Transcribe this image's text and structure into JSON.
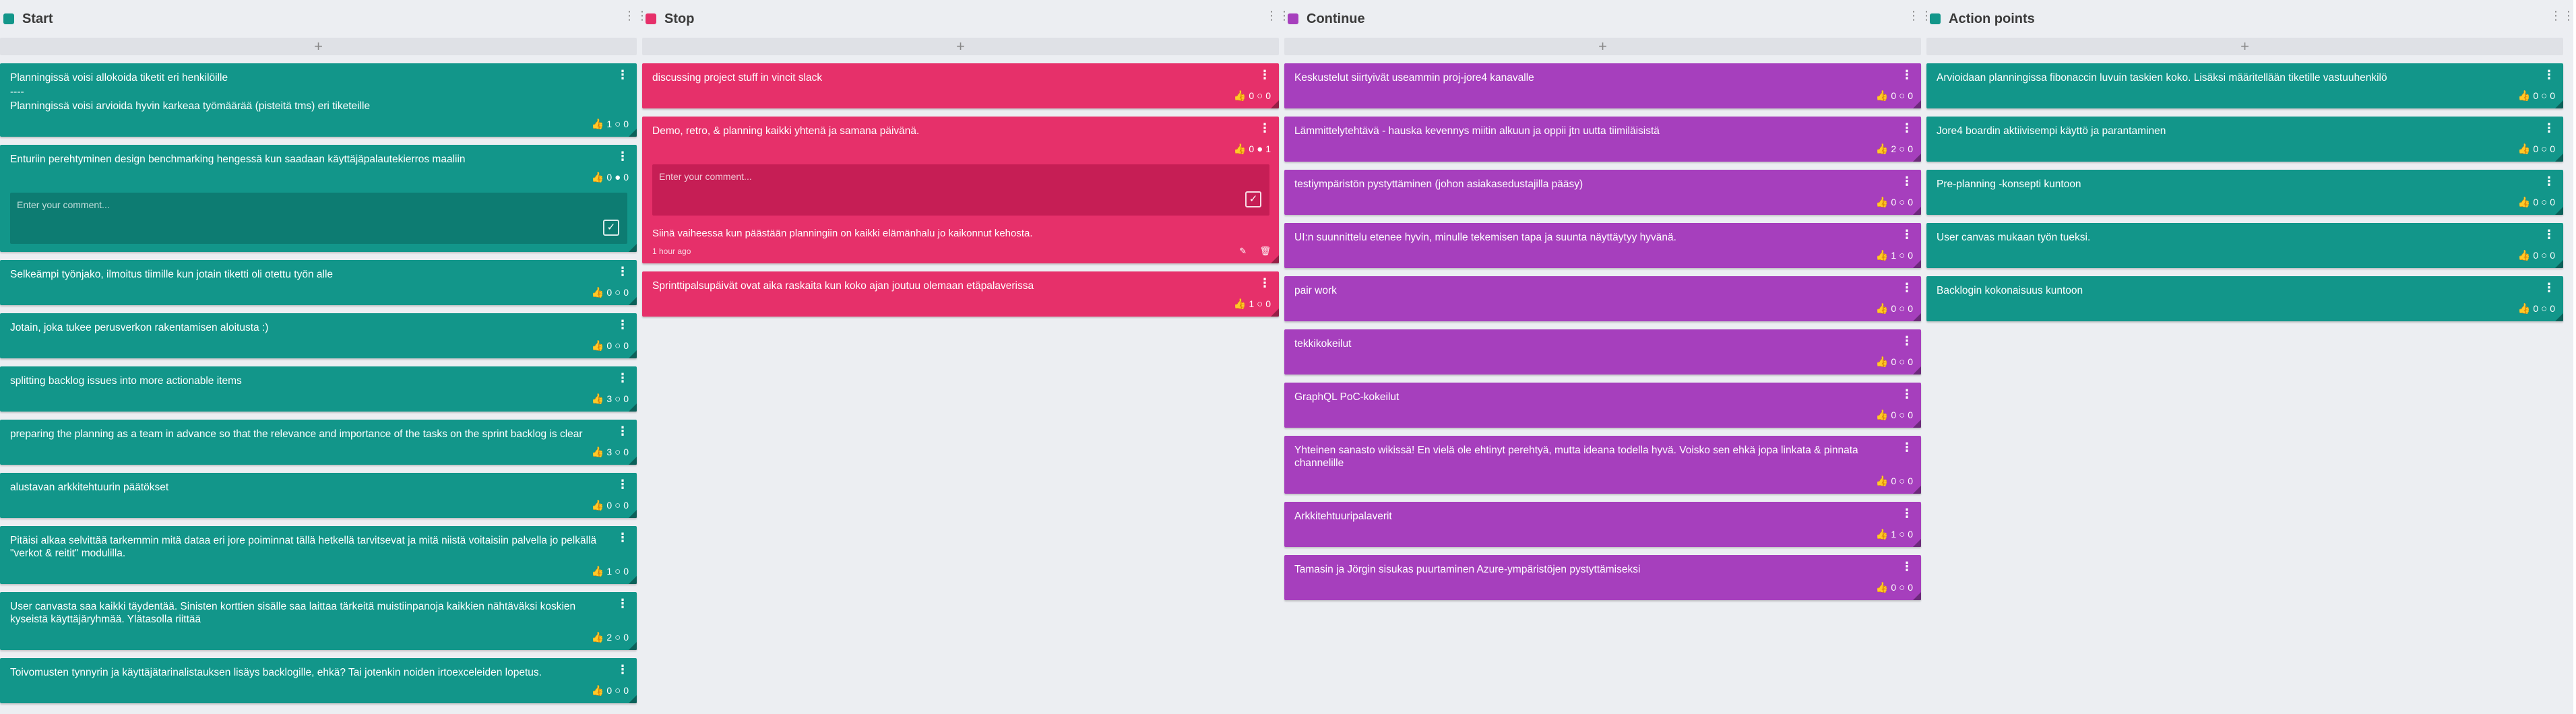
{
  "columns": [
    {
      "title": "Start",
      "color": "#12968a",
      "add": "+",
      "cards": [
        {
          "text": "Planningissä voisi allokoida tiketit eri henkilöille",
          "text2": "----",
          "text3": "Planningissä voisi arvioida hyvin karkeaa työmäärää (pisteitä tms) eri tiketeille",
          "likes": "1",
          "comments": "0"
        },
        {
          "text": "Enturiin perehtyminen design benchmarking hengessä kun saadaan käyttäjäpalautekierros maaliin",
          "likes": "0",
          "comments": "0",
          "comment_placeholder": "Enter your comment..."
        },
        {
          "text": "Selkeämpi työnjako, ilmoitus tiimille kun jotain tiketti oli otettu työn alle",
          "likes": "0",
          "comments": "0"
        },
        {
          "text": "Jotain, joka tukee perusverkon rakentamisen aloitusta :)",
          "likes": "0",
          "comments": "0"
        },
        {
          "text": "splitting backlog issues into more actionable items",
          "likes": "3",
          "comments": "0"
        },
        {
          "text": "preparing the planning as a team in advance so that the relevance and importance of the tasks on the sprint backlog is clear",
          "likes": "3",
          "comments": "0"
        },
        {
          "text": "alustavan arkkitehtuurin päätökset",
          "likes": "0",
          "comments": "0"
        },
        {
          "text": "Pitäisi alkaa selvittää tarkemmin mitä dataa eri jore poiminnat tällä hetkellä tarvitsevat ja mitä niistä voitaisiin palvella jo pelkällä \"verkot & reitit\" modulilla.",
          "likes": "1",
          "comments": "0"
        },
        {
          "text": "User canvasta saa kaikki täydentää. Sinisten korttien sisälle saa laittaa tärkeitä muistiinpanoja kaikkien nähtäväksi koskien kyseistä käyttäjäryhmää. Ylätasolla riittää",
          "likes": "2",
          "comments": "0"
        },
        {
          "text": "Toivomusten tynnyrin ja käyttäjätarinalistauksen lisäys backlogille, ehkä? Tai jotenkin noiden irtoexceleiden lopetus.",
          "likes": "0",
          "comments": "0"
        }
      ]
    },
    {
      "title": "Stop",
      "color": "#e6306a",
      "add": "+",
      "cards": [
        {
          "text": "discussing project stuff in vincit slack",
          "likes": "0",
          "comments": "0"
        },
        {
          "text": "Demo, retro, & planning kaikki yhtenä ja samana päivänä.",
          "likes": "0",
          "comments": "1",
          "comment_placeholder": "Enter your comment...",
          "comment_text": "Siinä vaiheessa kun päästään planningiin on kaikki elämänhalu jo kaikonnut kehosta.",
          "comment_time": "1 hour ago"
        },
        {
          "text": "Sprinttipalsupäivät ovat aika raskaita kun koko ajan joutuu olemaan etäpalaverissa",
          "likes": "1",
          "comments": "0"
        }
      ]
    },
    {
      "title": "Continue",
      "color": "#a63fbd",
      "add": "+",
      "cards": [
        {
          "text": "Keskustelut siirtyivät useammin proj-jore4 kanavalle",
          "likes": "0",
          "comments": "0"
        },
        {
          "text": "Lämmittelytehtävä - hauska kevennys miitin alkuun ja oppii jtn uutta tiimiläisistä",
          "likes": "2",
          "comments": "0"
        },
        {
          "text": "testiympäristön pystyttäminen (johon asiakasedustajilla pääsy)",
          "likes": "0",
          "comments": "0"
        },
        {
          "text": "UI:n suunnittelu etenee hyvin, minulle tekemisen tapa ja suunta näyttäytyy hyvänä.",
          "likes": "1",
          "comments": "0"
        },
        {
          "text": "pair work",
          "likes": "0",
          "comments": "0"
        },
        {
          "text": "tekkikokeilut",
          "likes": "0",
          "comments": "0"
        },
        {
          "text": "GraphQL PoC-kokeilut",
          "likes": "0",
          "comments": "0"
        },
        {
          "text": "Yhteinen sanasto wikissä! En vielä ole ehtinyt perehtyä, mutta ideana todella hyvä. Voisko sen ehkä jopa linkata & pinnata channelille",
          "likes": "0",
          "comments": "0"
        },
        {
          "text": "Arkkitehtuuripalaverit",
          "likes": "1",
          "comments": "0"
        },
        {
          "text": "Tamasin ja Jörgin sisukas puurtaminen Azure-ympäristöjen pystyttämiseksi",
          "likes": "0",
          "comments": "0"
        }
      ]
    },
    {
      "title": "Action points",
      "color": "#12968a",
      "add": "+",
      "cards": [
        {
          "text": "Arvioidaan planningissa fibonaccin luvuin taskien koko. Lisäksi määritellään tiketille vastuuhenkilö",
          "likes": "0",
          "comments": "0"
        },
        {
          "text": "Jore4 boardin aktiivisempi käyttö ja parantaminen",
          "likes": "0",
          "comments": "0"
        },
        {
          "text": "Pre-planning -konsepti kuntoon",
          "likes": "0",
          "comments": "0"
        },
        {
          "text": "User canvas mukaan työn tueksi.",
          "likes": "0",
          "comments": "0"
        },
        {
          "text": "Backlogin kokonaisuus kuntoon",
          "likes": "0",
          "comments": "0"
        }
      ]
    }
  ]
}
